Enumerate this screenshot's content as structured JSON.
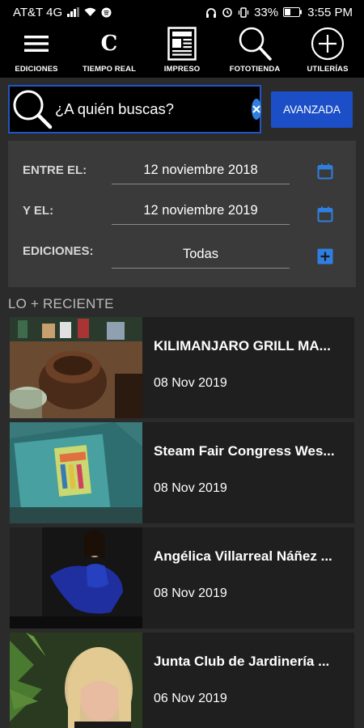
{
  "status_bar": {
    "carrier": "AT&T 4G",
    "battery": "33%",
    "time": "3:55 PM"
  },
  "nav": [
    {
      "label": "EDICIONES",
      "icon": "hamburger-menu-icon"
    },
    {
      "label": "TIEMPO REAL",
      "icon": "c-letter-icon",
      "glyph": "C"
    },
    {
      "label": "IMPRESO",
      "icon": "newspaper-icon"
    },
    {
      "label": "FOTOTIENDA",
      "icon": "search-icon"
    },
    {
      "label": "UTILERÍAS",
      "icon": "plus-circle-icon"
    }
  ],
  "search": {
    "placeholder": "¿A quién buscas?",
    "advanced_label": "AVANZADA",
    "accent": "#1f56c7"
  },
  "filters": {
    "from_label": "ENTRE EL:",
    "from_value": "12 noviembre 2018",
    "to_label": "Y EL:",
    "to_value": "12 noviembre 2019",
    "editions_label": "EDICIONES:",
    "editions_value": "Todas"
  },
  "recent": {
    "title": "LO + RECIENTE",
    "items": [
      {
        "title": "KILIMANJARO GRILL MA...",
        "date": "08 Nov 2019"
      },
      {
        "title": "Steam Fair Congress Wes...",
        "date": "08 Nov 2019"
      },
      {
        "title": "Angélica Villarreal Náñez ...",
        "date": "08 Nov 2019"
      },
      {
        "title": "Junta Club de Jardinería ...",
        "date": "06 Nov 2019"
      }
    ]
  }
}
